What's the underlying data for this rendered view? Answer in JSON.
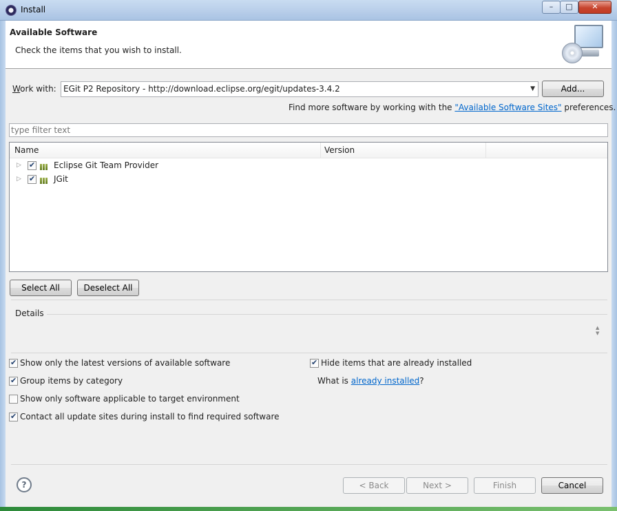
{
  "window": {
    "title": "Install",
    "minimize": "–",
    "maximize": "□",
    "close": "✕"
  },
  "header": {
    "title": "Available Software",
    "message": "Check the items that you wish to install."
  },
  "work_with": {
    "label": "Work with:",
    "value": "EGit P2 Repository - http://download.eclipse.org/egit/updates-3.4.2",
    "add_button": "Add...",
    "find_more_prefix": "Find more software by working with the ",
    "find_more_link": "\"Available Software Sites\"",
    "find_more_suffix": " preferences."
  },
  "filter": {
    "placeholder": "type filter text"
  },
  "tree": {
    "columns": [
      "Name",
      "Version"
    ],
    "rows": [
      {
        "label": "Eclipse Git Team Provider",
        "checked": true,
        "icon": "feature-group-icon"
      },
      {
        "label": "JGit",
        "checked": true,
        "icon": "feature-group-icon"
      }
    ]
  },
  "actions": {
    "select_all": "Select All",
    "deselect_all": "Deselect All"
  },
  "details": {
    "label": "Details"
  },
  "options": {
    "latest_versions": "Show only the latest versions of available software",
    "group_by_category": "Group items by category",
    "target_env": "Show only software applicable to target environment",
    "contact_sites": "Contact all update sites during install to find required software",
    "hide_installed": "Hide items that are already installed",
    "what_is_prefix": "What is ",
    "what_is_link": "already installed",
    "what_is_suffix": "?"
  },
  "footer": {
    "help": "?",
    "back": "< Back",
    "next": "Next >",
    "finish": "Finish",
    "cancel": "Cancel"
  }
}
